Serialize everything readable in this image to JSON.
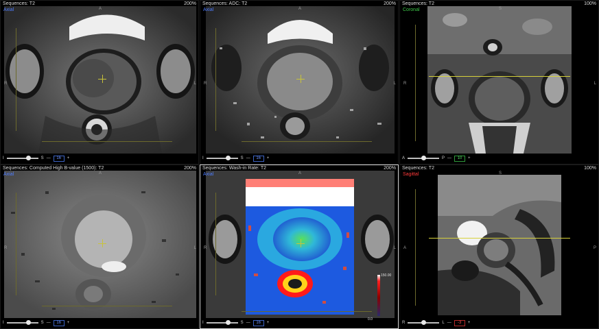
{
  "panels": [
    {
      "header": "Sequences: T2",
      "zoom": "200%",
      "plane": "Axial",
      "orient": {
        "top": "A",
        "left": "R",
        "right": "L"
      },
      "footer": {
        "left": "I",
        "mid": "S",
        "value": "16"
      }
    },
    {
      "header": "Sequences: ADC: T2",
      "zoom": "200%",
      "plane": "Axial",
      "orient": {
        "top": "A",
        "left": "R",
        "right": "L"
      },
      "footer": {
        "left": "I",
        "mid": "S",
        "value": "16"
      }
    },
    {
      "header": "Sequences: T2",
      "zoom": "100%",
      "plane": "Coronal",
      "orient": {
        "top": "S",
        "left": "R",
        "right": "L"
      },
      "footer": {
        "left": "A",
        "mid": "P",
        "value": "10"
      }
    },
    {
      "header": "Sequences: Computed High B-value (1500): T2",
      "zoom": "200%",
      "plane": "Axial",
      "orient": {
        "top": "A",
        "left": "R",
        "right": "L"
      },
      "footer": {
        "left": "I",
        "mid": "S",
        "value": "16"
      }
    },
    {
      "header": "Sequences: Wash-in Rate: T2",
      "zoom": "200%",
      "plane": "Axial",
      "orient": {
        "top": "A",
        "left": "R",
        "right": "L"
      },
      "footer": {
        "left": "I",
        "mid": "S",
        "value": "16"
      },
      "legend": {
        "top": "150.00",
        "bottom": "0.0"
      }
    },
    {
      "header": "Sequences: T2",
      "zoom": "100%",
      "plane": "Sagittal",
      "orient": {
        "top": "S",
        "left": "A",
        "right": "P"
      },
      "footer": {
        "left": "R",
        "mid": "L",
        "value": "-3"
      }
    }
  ],
  "plus_glyph": "+"
}
